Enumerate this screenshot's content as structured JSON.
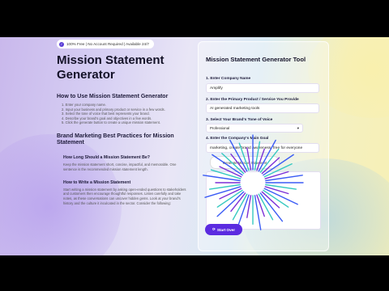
{
  "badge": {
    "text": "100% Free | No Account Required | Available 24/7"
  },
  "page_title": "Mission Statement Generator",
  "how_to": {
    "heading": "How to Use Mission Statement Generator",
    "steps": [
      "1. Enter your company name.",
      "2. Input your business and primary product or service in a few words.",
      "3. Select the tone of voice that best represents your brand.",
      "4. Describe your brand's goal and objectives in a few words.",
      "5. Click the generate button to create a unique mission statement."
    ]
  },
  "best_practices": {
    "heading": "Brand Marketing Best Practices for Mission Statement",
    "q1": {
      "title": "How Long Should a Mission Statement Be?",
      "text": "Keep the mission statement short, concise, impactful, and memorable. One sentence is the recommended mission statement length."
    },
    "q2": {
      "title": "How to Write a Mission Statement",
      "text": "Start writing a mission statement by asking open-ended questions to stakeholders and customers then encourage thoughtful responses. Listen carefully and take notes, as these conversations can uncover hidden gems. Look at your brand's history and the culture it inculcated in the sector. Consider the following:"
    }
  },
  "tool": {
    "title": "Mission Statement Generator Tool",
    "field1": {
      "label": "1. Enter Company Name",
      "value": "Amplify"
    },
    "field2": {
      "label": "2. Enter the Primary Product / Service You Provide",
      "value": "AI generated marketing tools"
    },
    "field3": {
      "label": "3. Select Your Brand's Tone of Voice",
      "value": "Professional"
    },
    "field4": {
      "label": "4. Enter the Company's Main Goal",
      "value": "marketing, create brand awareness, free for everyone"
    },
    "generate_label": "Generate Mission Statement",
    "start_over_label": "Start Over",
    "start_icon": "refresh-icon"
  },
  "colors": {
    "accent": "#5b2be0",
    "burst_blue": "#3b5cf5",
    "burst_teal": "#35c9c0",
    "burst_purple": "#7b2fd6"
  }
}
